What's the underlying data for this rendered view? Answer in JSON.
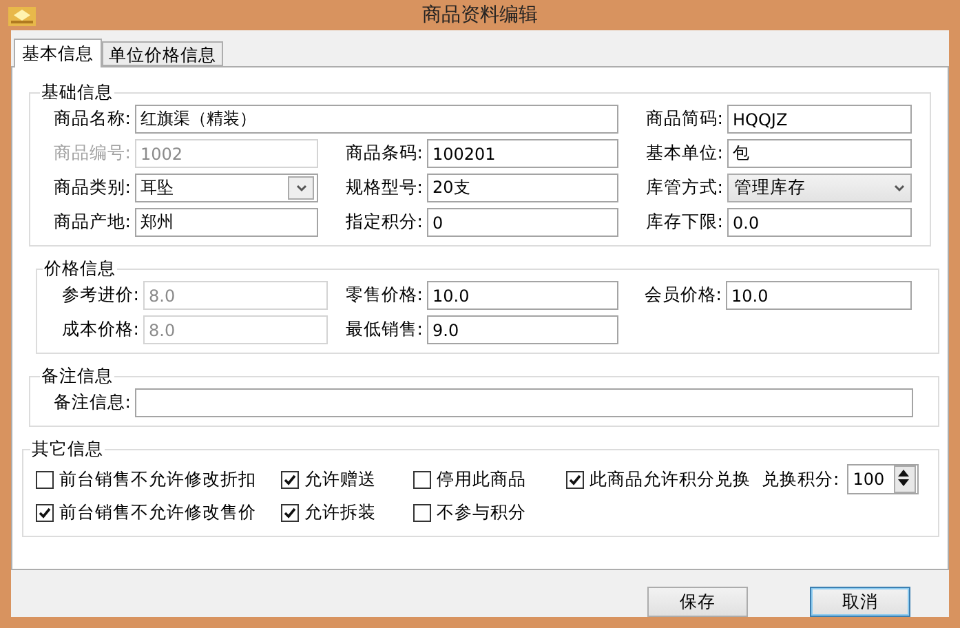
{
  "window": {
    "title": "商品资料编辑"
  },
  "tabs": [
    {
      "label": "基本信息",
      "selected": true
    },
    {
      "label": "单位价格信息",
      "selected": false
    }
  ],
  "basic_info": {
    "title": "基础信息",
    "fields": [
      {
        "label": "商品名称:",
        "value": "红旗渠（精装）",
        "kind": "text",
        "disabled": false
      },
      {
        "label": "商品简码:",
        "value": "HQQJZ",
        "kind": "text",
        "disabled": false
      },
      {
        "label": "商品编号:",
        "value": "1002",
        "kind": "text",
        "disabled": true
      },
      {
        "label": "商品条码:",
        "value": "100201",
        "kind": "text",
        "disabled": false
      },
      {
        "label": "基本单位:",
        "value": "包",
        "kind": "text",
        "disabled": false
      },
      {
        "label": "商品类别:",
        "value": "耳坠",
        "kind": "combo",
        "disabled": false
      },
      {
        "label": "规格型号:",
        "value": "20支",
        "kind": "text",
        "disabled": false
      },
      {
        "label": "库管方式:",
        "value": "管理库存",
        "kind": "select",
        "disabled": false
      },
      {
        "label": "商品产地:",
        "value": "郑州",
        "kind": "text",
        "disabled": false
      },
      {
        "label": "指定积分:",
        "value": "0",
        "kind": "text",
        "disabled": false
      },
      {
        "label": "库存下限:",
        "value": "0.0",
        "kind": "text",
        "disabled": false
      }
    ]
  },
  "price_info": {
    "title": "价格信息",
    "fields": [
      {
        "label": "参考进价:",
        "value": "8.0",
        "disabled": true
      },
      {
        "label": "零售价格:",
        "value": "10.0",
        "disabled": false
      },
      {
        "label": "会员价格:",
        "value": "10.0",
        "disabled": false
      },
      {
        "label": "成本价格:",
        "value": "8.0",
        "disabled": true
      },
      {
        "label": "最低销售:",
        "value": "9.0",
        "disabled": false
      }
    ]
  },
  "remark_info": {
    "title": "备注信息",
    "label": "备注信息:"
  },
  "other_info": {
    "title": "其它信息",
    "options": [
      {
        "label": "前台销售不允许修改折扣",
        "checked": false
      },
      {
        "label": "允许赠送",
        "checked": true
      },
      {
        "label": "停用此商品",
        "checked": false
      },
      {
        "label": "此商品允许积分兑换",
        "checked": true
      },
      {
        "label": "前台销售不允许修改售价",
        "checked": true
      },
      {
        "label": "允许拆装",
        "checked": true
      },
      {
        "label": "不参与积分",
        "checked": false
      }
    ],
    "points": {
      "label": "兑换积分:",
      "value": "100"
    }
  },
  "buttons": [
    {
      "label": "保存",
      "default": false
    },
    {
      "label": "取消",
      "default": true
    }
  ]
}
